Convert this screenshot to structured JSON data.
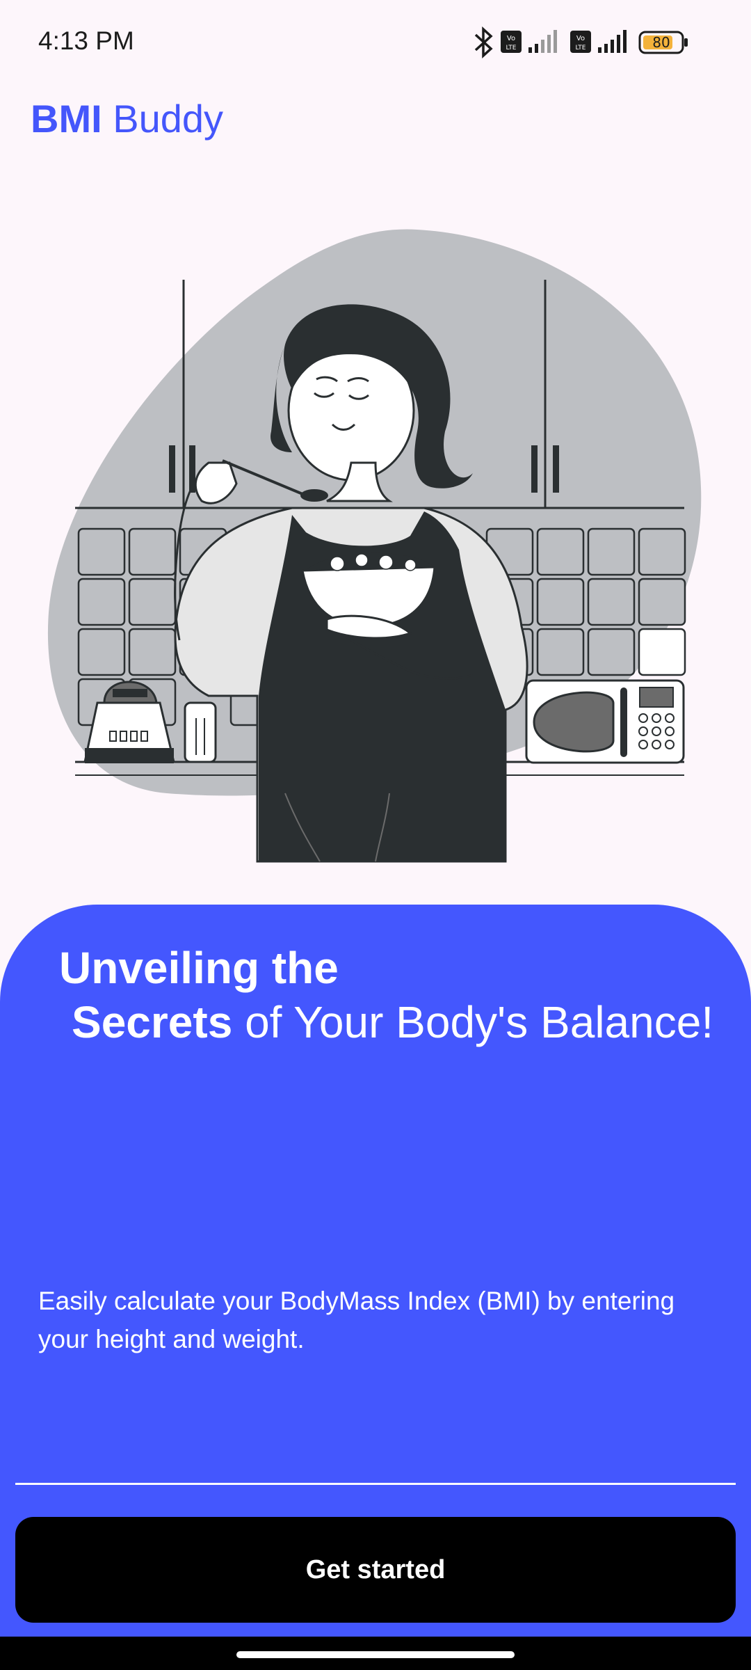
{
  "status_bar": {
    "time": "4:13 PM",
    "battery": "80",
    "icons": [
      "bluetooth-icon",
      "volte-icon",
      "signal-icon",
      "volte-icon",
      "signal-icon",
      "battery-icon"
    ]
  },
  "app": {
    "title_bold": "BMI",
    "title_rest": " Buddy"
  },
  "hero": {
    "illustration": "woman-eating-salad-kitchen-illustration"
  },
  "intro": {
    "headline_line1": "Unveiling the",
    "headline_bold": "Secrets",
    "headline_rest": " of Your Body's Balance!",
    "description": "Easily calculate your BodyMass Index (BMI) by entering your height and weight.",
    "cta_label": "Get started"
  },
  "colors": {
    "accent": "#4457fe",
    "background": "#fdf6fb",
    "button": "#000000"
  }
}
